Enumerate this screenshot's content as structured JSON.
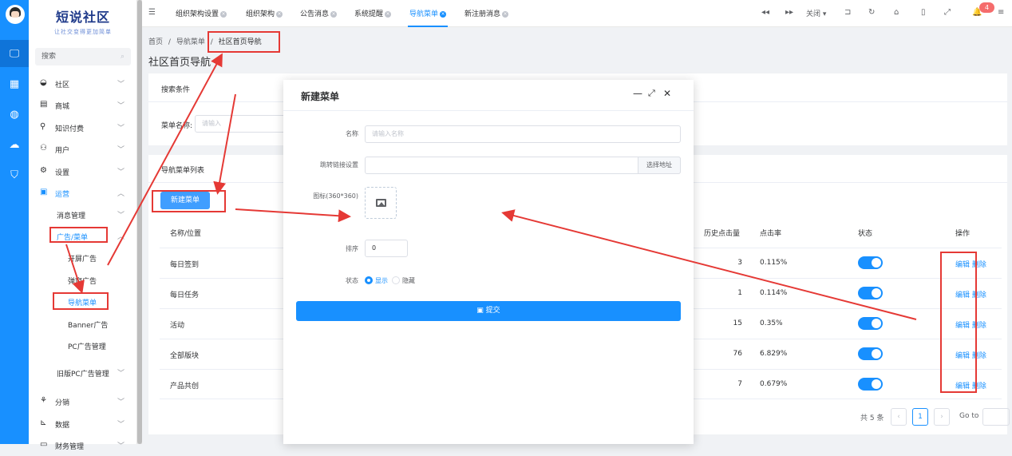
{
  "sidebar": {
    "logo_title": "短说社区",
    "logo_sub": "让社交变得更加简单",
    "search_label": "搜索",
    "menu": [
      {
        "label": "社区",
        "icon": "chat-icon"
      },
      {
        "label": "商城",
        "icon": "store-icon"
      },
      {
        "label": "知识付费",
        "icon": "location-icon"
      },
      {
        "label": "用户",
        "icon": "user-icon"
      },
      {
        "label": "设置",
        "icon": "gear-icon"
      },
      {
        "label": "运营",
        "icon": "operation-icon"
      }
    ],
    "sub": [
      {
        "label": "消息管理"
      },
      {
        "label": "广告/菜单"
      },
      {
        "label": "开屏广告"
      },
      {
        "label": "弹窗广告"
      },
      {
        "label": "导航菜单"
      },
      {
        "label": "Banner广告"
      },
      {
        "label": "PC广告管理"
      },
      {
        "label": "旧版PC广告管理"
      }
    ],
    "menu2": [
      {
        "label": "分销",
        "icon": "share-icon"
      },
      {
        "label": "数据",
        "icon": "chart-icon"
      },
      {
        "label": "财务管理",
        "icon": "wallet-icon"
      }
    ]
  },
  "tabs": [
    {
      "label": "组织架构设置"
    },
    {
      "label": "组织架构"
    },
    {
      "label": "公告消息"
    },
    {
      "label": "系统提醒"
    },
    {
      "label": "导航菜单"
    },
    {
      "label": "新注册消息"
    }
  ],
  "toolbar": {
    "close_label": "关闭",
    "badge": "4"
  },
  "breadcrumb": {
    "home": "首页",
    "parent": "导航菜单",
    "current": "社区首页导航",
    "sep": "/"
  },
  "page_title": "社区首页导航",
  "search": {
    "title": "搜索条件",
    "field_label": "菜单名称:",
    "placeholder": "请输入"
  },
  "list": {
    "title": "导航菜单列表",
    "new_button": "新建菜单",
    "headers": {
      "name": "名称/位置",
      "clicks": "历史点击量",
      "rate": "点击率",
      "status": "状态",
      "ops": "操作"
    },
    "rows": [
      {
        "name": "每日签到",
        "clicks": "3",
        "rate": "0.115%"
      },
      {
        "name": "每日任务",
        "clicks": "1",
        "rate": "0.114%"
      },
      {
        "name": "活动",
        "clicks": "15",
        "rate": "0.35%"
      },
      {
        "name": "全部版块",
        "clicks": "76",
        "rate": "6.829%"
      },
      {
        "name": "产品共创",
        "clicks": "7",
        "rate": "0.679%"
      }
    ],
    "edit_label": "编辑",
    "delete_label": "删除"
  },
  "pagination": {
    "total": "共 5 条",
    "page": "1",
    "goto": "Go to"
  },
  "modal": {
    "title": "新建菜单",
    "name_label": "名称",
    "name_placeholder": "请输入名称",
    "link_label": "跳转链接设置",
    "link_button": "选择地址",
    "icon_label": "图标(360*360)",
    "order_label": "排序",
    "order_value": "0",
    "status_label": "状态",
    "show_label": "显示",
    "hide_label": "隐藏",
    "submit_label": "提交"
  },
  "colors": {
    "accent": "#1890ff",
    "annotation": "#e53935"
  }
}
